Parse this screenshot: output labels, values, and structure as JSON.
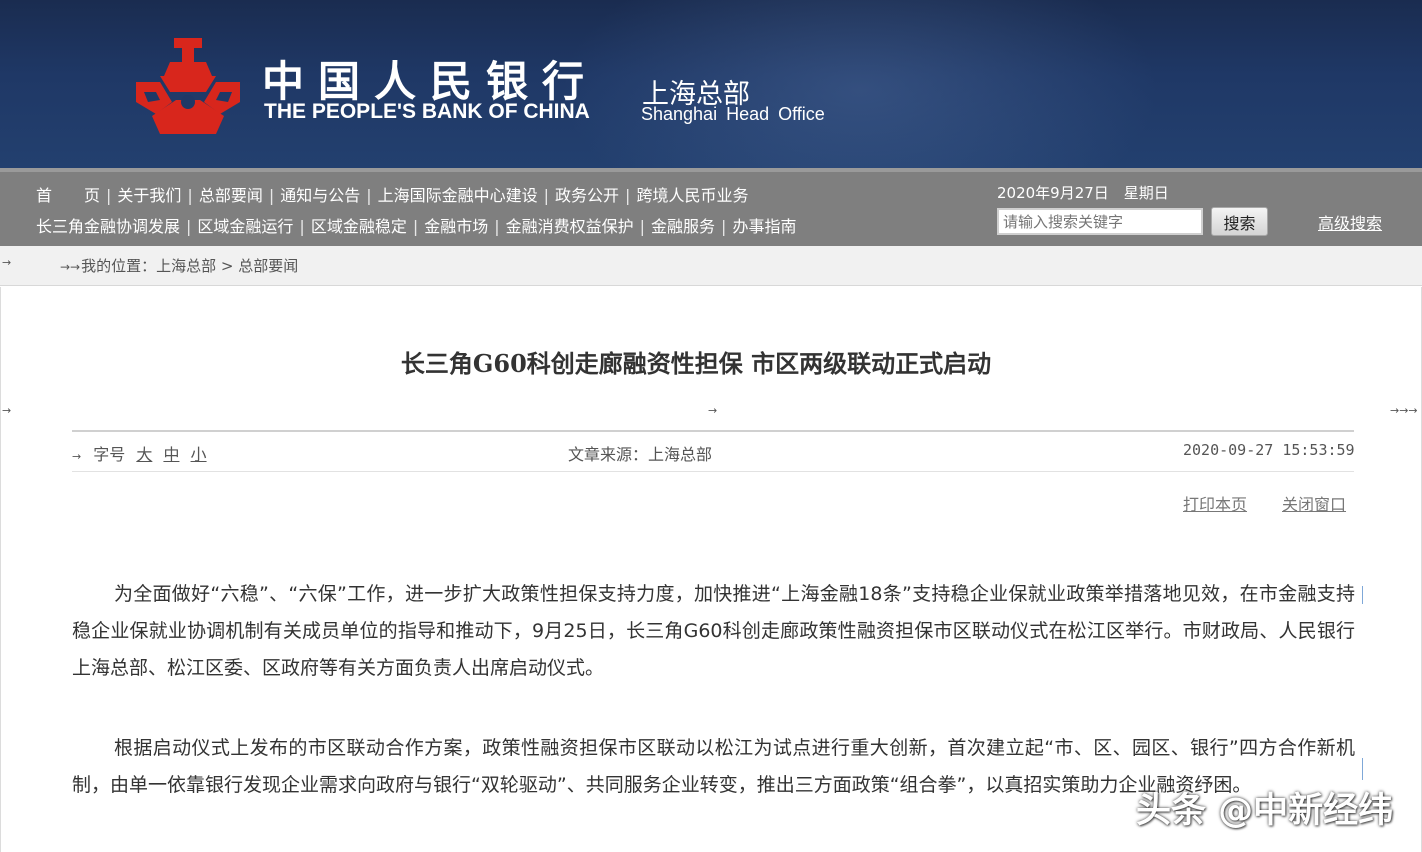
{
  "header": {
    "logo_cn": "中国人民银行",
    "logo_en": "THE PEOPLE'S BANK OF CHINA",
    "office_cn": "上海总部",
    "office_en": "Shanghai Head Office",
    "logo_color": "#d8261c",
    "banner_color": "#1f3866"
  },
  "nav": {
    "row1": [
      "首　　页",
      "关于我们",
      "总部要闻",
      "通知与公告",
      "上海国际金融中心建设",
      "政务公开",
      "跨境人民币业务"
    ],
    "row2": [
      "长三角金融协调发展",
      "区域金融运行",
      "区域金融稳定",
      "金融市场",
      "金融消费权益保护",
      "金融服务",
      "办事指南"
    ],
    "separator": "|",
    "date": "2020年9月27日　星期日",
    "search_placeholder": "请输入搜索关键字",
    "search_button": "搜索",
    "advanced_search": "高级搜索"
  },
  "breadcrumb": {
    "lead": "→→",
    "label": "我的位置：",
    "items": [
      "上海总部",
      "总部要闻"
    ],
    "separator": ">"
  },
  "article": {
    "title": "长三角G60科创走廊融资性担保 市区两级联动正式启动",
    "font_size_label": "字号",
    "font_sizes": [
      "大",
      "中",
      "小"
    ],
    "source": "文章来源：上海总部",
    "datetime": "2020-09-27 15:53:59",
    "print_label": "打印本页",
    "close_label": "关闭窗口",
    "paragraphs": [
      "为全面做好“六稳”、“六保”工作，进一步扩大政策性担保支持力度，加快推进“上海金融18条”支持稳企业保就业政策举措落地见效，在市金融支持稳企业保就业协调机制有关成员单位的指导和推动下，9月25日，长三角G60科创走廊政策性融资担保市区联动仪式在松江区举行。市财政局、人民银行上海总部、松江区委、区政府等有关方面负责人出席启动仪式。",
      "根据启动仪式上发布的市区联动合作方案，政策性融资担保市区联动以松江为试点进行重大创新，首次建立起“市、区、园区、银行”四方合作新机制，由单一依靠银行发现企业需求向政府与银行“双轮驱动”、共同服务企业转变，推出三方面政策“组合拳”，以真招实策助力企业融资纾困。"
    ]
  },
  "watermark": "头条 @中新经纬"
}
